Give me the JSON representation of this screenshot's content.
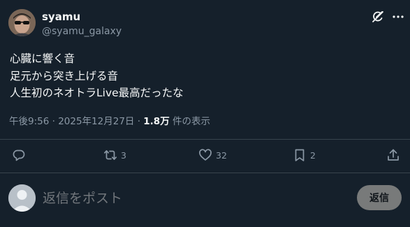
{
  "author": {
    "name": "syamu",
    "handle": "@syamu_galaxy"
  },
  "tweet": {
    "lines": [
      "心臓に響く音",
      "足元から突き上げる音",
      "人生初のネオトラLive最高だったな"
    ]
  },
  "meta": {
    "timestamp": "午後9:56 · 2025年12月27日 · ",
    "views_count": "1.8万",
    "views_suffix": " 件の表示"
  },
  "actions": {
    "retweets": "3",
    "likes": "32",
    "bookmarks": "2"
  },
  "reply": {
    "placeholder": "返信をポスト",
    "button_label": "返信"
  },
  "icons": [
    "grok-icon",
    "more-icon",
    "reply-icon",
    "retweet-icon",
    "like-icon",
    "bookmark-icon",
    "share-icon"
  ],
  "colors": {
    "background": "#15202b",
    "text": "#f7f9f9",
    "secondary_text": "#8b98a5",
    "divider": "#38444d",
    "reply_button": "#787a7a"
  }
}
